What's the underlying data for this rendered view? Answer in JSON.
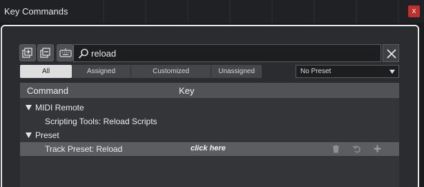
{
  "window": {
    "title": "Key Commands",
    "close_label": "x"
  },
  "toolbar": {
    "buttons": [
      "expand-all-icon",
      "collapse-all-icon",
      "keyboard-icon"
    ],
    "search": {
      "value": "reload"
    }
  },
  "filters": [
    {
      "label": "All",
      "active": true
    },
    {
      "label": "Assigned",
      "active": false
    },
    {
      "label": "Customized",
      "active": false
    },
    {
      "label": "Unassigned",
      "active": false
    }
  ],
  "preset": {
    "selected": "No Preset"
  },
  "table": {
    "columns": {
      "command": "Command",
      "key": "Key"
    },
    "rows": [
      {
        "type": "category",
        "label": "MIDI Remote"
      },
      {
        "type": "command",
        "label": "Scripting Tools: Reload Scripts"
      },
      {
        "type": "category",
        "label": "Preset"
      },
      {
        "type": "command",
        "label": "Track Preset: Reload",
        "key_hint": "click here",
        "selected": true
      }
    ]
  },
  "colors": {
    "accent_close": "#c0302c",
    "selected_row": "#5b5d61",
    "active_filter": "#dedede"
  }
}
